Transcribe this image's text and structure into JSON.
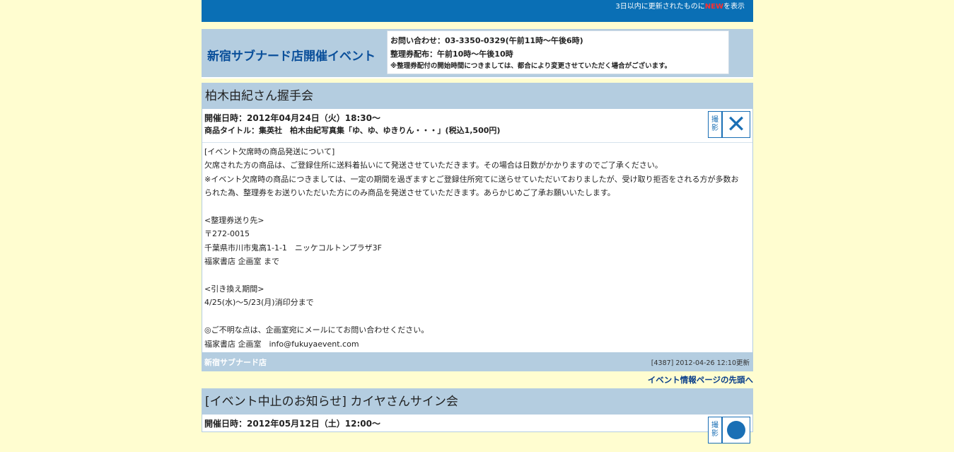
{
  "topbar": {
    "text_before": "3日以内に更新されたものに",
    "new_badge": "NEW",
    "text_after": "を表示"
  },
  "header": {
    "shop_title": "新宿サブナード店開催イベント",
    "contact": "お問い合わせ：03-3350-0329(午前11時～午後6時)",
    "ticket": "整理券配布：午前10時～午後10時",
    "note": "※整理券配付の開始時間につきましては、都合により変更させていただく場合がございます。"
  },
  "event1": {
    "title": "柏木由紀さん握手会",
    "date": "開催日時：2012年04月24日（火）18:30～",
    "product": "商品タイトル：集英社　柏木由紀写真集「ゆ、ゆ、ゆきりん・・・」(税込1,500円)",
    "photo_icon_label": "撮影",
    "body": [
      "[イベント欠席時の商品発送について]",
      "欠席された方の商品は、ご登録住所に送料着払いにて発送させていただきます。その場合は日数がかかりますのでご了承ください。",
      "※イベント欠席時の商品につきましては、一定の期間を過ぎますとご登録住所宛てに送らせていただいておりましたが、受け取り拒否をされる方が多数お",
      "られた為、整理券をお送りいただいた方にのみ商品を発送させていただきます。あらかじめご了承お願いいたします。",
      "",
      "<整理券送り先>",
      "〒272-0015",
      "千葉県市川市鬼高1-1-1　ニッケコルトンプラザ3F",
      "福家書店 企画室 まで",
      "",
      "<引き換え期間>",
      "4/25(水)～5/23(月)消印分まで",
      "",
      "◎ご不明な点は、企画室宛にメールにてお問い合わせください。",
      "福家書店 企画室　info@fukuyaevent.com"
    ],
    "footer_shop": "新宿サブナード店",
    "updated": "[4387] 2012-04-26 12:10更新"
  },
  "to_top": "イベント情報ページの先頭へ",
  "event2": {
    "title": "[イベント中止のお知らせ] カイヤさんサイン会",
    "date": "開催日時：2012年05月12日（土）12:00～",
    "photo_icon_label": "撮影"
  },
  "colors": {
    "background": "#fffdd0",
    "topbar": "#0a6fb5",
    "panel": "#b4cde0",
    "accent": "#1a6fb5"
  }
}
